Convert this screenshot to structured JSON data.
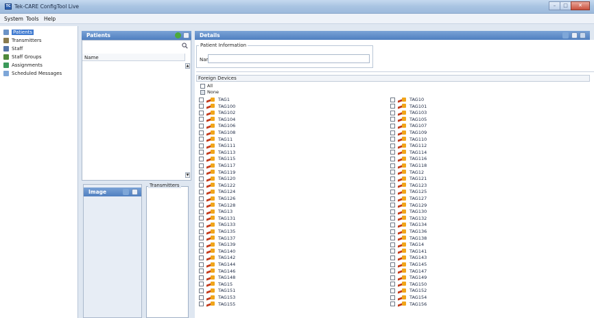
{
  "window": {
    "title": "Tek-CARE ConfigTool Live"
  },
  "menu": [
    "System",
    "Tools",
    "Help"
  ],
  "nav": [
    {
      "label": "Patients",
      "icon": "patient-icon",
      "selected": true
    },
    {
      "label": "Transmitters",
      "icon": "transmitter-icon"
    },
    {
      "label": "Staff",
      "icon": "staff-icon"
    },
    {
      "label": "Staff Groups",
      "icon": "staff-groups-icon"
    },
    {
      "label": "Assignments",
      "icon": "assignments-icon"
    },
    {
      "label": "Scheduled Messages",
      "icon": "scheduled-messages-icon"
    }
  ],
  "patients": {
    "title": "Patients",
    "column_name": "Name"
  },
  "image": {
    "title": "Image"
  },
  "transmitters_box": {
    "label": "Transmitters"
  },
  "details": {
    "title": "Details",
    "patient_info_label": "Patient Information",
    "name_label": "Name:",
    "name_value": ""
  },
  "foreign_devices": {
    "header": "Foreign Devices",
    "options": [
      "All",
      "None"
    ],
    "left_tags": [
      "TAG1",
      "TAG100",
      "TAG102",
      "TAG104",
      "TAG106",
      "TAG108",
      "TAG11",
      "TAG111",
      "TAG113",
      "TAG115",
      "TAG117",
      "TAG119",
      "TAG120",
      "TAG122",
      "TAG124",
      "TAG126",
      "TAG128",
      "TAG13",
      "TAG131",
      "TAG133",
      "TAG135",
      "TAG137",
      "TAG139",
      "TAG140",
      "TAG142",
      "TAG144",
      "TAG146",
      "TAG148",
      "TAG15",
      "TAG151",
      "TAG153",
      "TAG155"
    ],
    "right_tags": [
      "TAG10",
      "TAG101",
      "TAG103",
      "TAG105",
      "TAG107",
      "TAG109",
      "TAG110",
      "TAG112",
      "TAG114",
      "TAG116",
      "TAG118",
      "TAG12",
      "TAG121",
      "TAG123",
      "TAG125",
      "TAG127",
      "TAG129",
      "TAG130",
      "TAG132",
      "TAG134",
      "TAG136",
      "TAG138",
      "TAG14",
      "TAG141",
      "TAG143",
      "TAG145",
      "TAG147",
      "TAG149",
      "TAG150",
      "TAG152",
      "TAG154",
      "TAG156"
    ]
  },
  "colors": {
    "accent": "#4f7fc0",
    "selection": "#3f7ad0",
    "tag_icon": "#c23a1b"
  }
}
